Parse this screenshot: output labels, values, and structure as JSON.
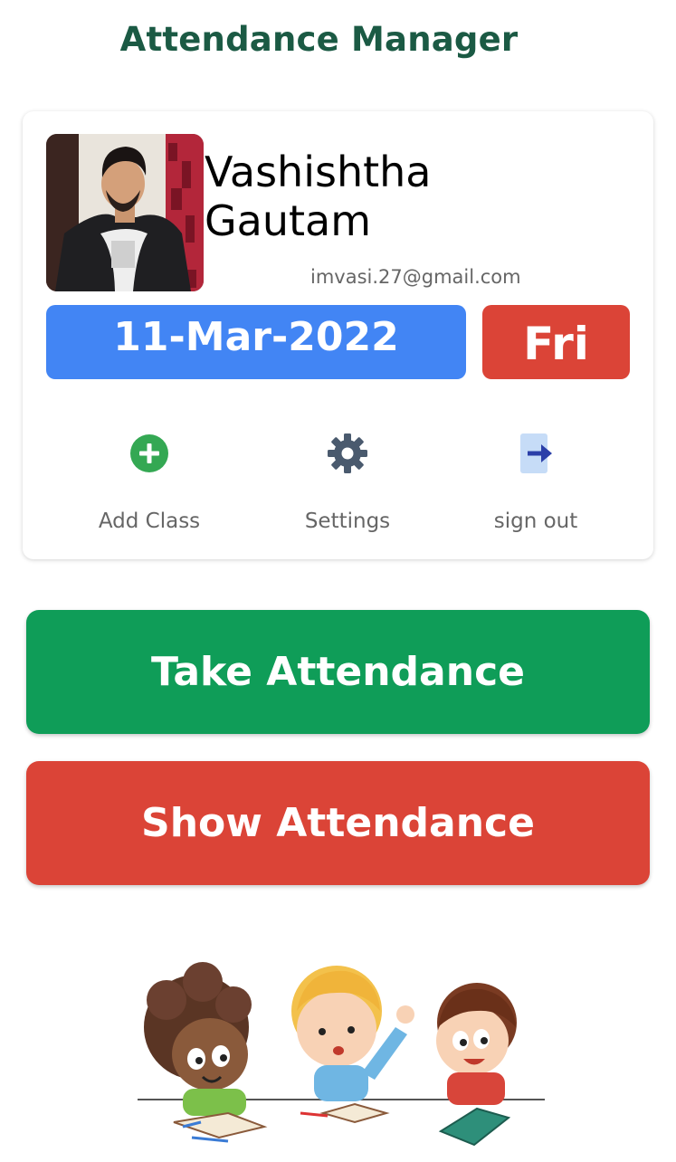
{
  "app": {
    "title": "Attendance Manager"
  },
  "profile": {
    "name": "Vashishtha Gautam",
    "email": "imvasi.27@gmail.com",
    "avatar_icon": "profile-photo"
  },
  "date": {
    "value": "11-Mar-2022",
    "day": "Fri"
  },
  "actions": [
    {
      "label": "Add Class",
      "icon": "add-circle-icon"
    },
    {
      "label": "Settings",
      "icon": "gear-icon"
    },
    {
      "label": "sign out",
      "icon": "exit-arrow-icon"
    }
  ],
  "buttons": {
    "take": "Take Attendance",
    "show": "Show Attendance"
  },
  "colors": {
    "title": "#1b5a44",
    "date_bg": "#4285f4",
    "day_bg": "#db4437",
    "take_bg": "#0f9d58",
    "show_bg": "#db4437",
    "add_icon": "#34a853",
    "settings_icon": "#4a5a6e"
  }
}
